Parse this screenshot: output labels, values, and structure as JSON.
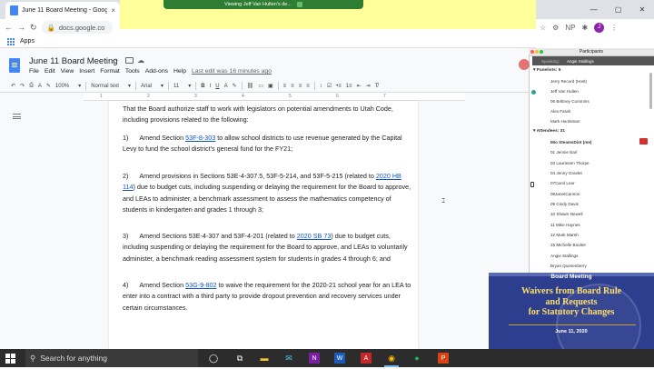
{
  "browser": {
    "tab_title": "June 11 Board Meeting - Google",
    "url": "docs.google.co",
    "bookmarks_apps": "Apps",
    "zoom_share_text": "Viewing Jeff Van Hulten's de...",
    "profile_initial": "J",
    "ext_label": "NP"
  },
  "doc": {
    "title": "June 11 Board Meeting",
    "menus": [
      "File",
      "Edit",
      "View",
      "Insert",
      "Format",
      "Tools",
      "Add-ons",
      "Help"
    ],
    "last_edit": "Last edit was 16 minutes ago",
    "toolbar": {
      "zoom": "100%",
      "style": "Normal text",
      "font": "Arial",
      "size": "11"
    },
    "ruler_marks": [
      "1",
      "2",
      "3",
      "4",
      "5",
      "6",
      "7"
    ],
    "paragraphs": {
      "intro": "That the Board authorize staff to work with legislators on potential amendments to Utah Code, including provisions related to the following:",
      "p1_pre": "1)      Amend Section ",
      "p1_link": "53F-8-303",
      "p1_post": " to allow school districts to use revenue generated by the Capital Levy to fund the school district's general fund for the FY21;",
      "p2_pre": "2)      Amend provisions in Sections 53E-4-307.5, 53F-5-214, and 53F-5-215 (related to ",
      "p2_link": "2020 HB 114",
      "p2_post": ") due to budget cuts, including suspending or delaying the requirement for the Board to approve, and LEAs to administer, a benchmark assessment to assess the mathematics competency of students in kindergarten and grades 1 through 3;",
      "p3_pre": "3)      Amend Sections 53E-4-307 and 53F-4-201 (related to ",
      "p3_link": "2020 SB 73",
      "p3_post": ") due to budget cuts, including suspending or delaying the requirement for the Board to approve, and LEAs to voluntarily administer, a benchmark reading assessment system for students in grades 4 through 6; and",
      "p4_pre": "4)      Amend Section ",
      "p4_link": "53G-9-802",
      "p4_post": " to waive the requirement for the 2020-21 school year for an LEA to enter into a contract with a third party to provide dropout prevention and recovery services under certain circumstances."
    }
  },
  "participants": {
    "title": "Participants",
    "speaking_label": "Speaking:",
    "speaking_name": "Angie Stallings",
    "panelists_header": "Panelists: 5",
    "panelists": [
      "Jerry Record (Host)",
      "Jeff Van Hulten",
      "06 Brittney Cummins",
      "Alex Farah",
      "Mark Huntsman"
    ],
    "attendees_header": "Attendees: 31",
    "attendees": [
      "Mio SteamsDiot (me)",
      "01 Jennie Earl",
      "03 Laurieann Thorpe",
      "04 Jenny Gravlet",
      "07Carol Lear",
      "08JanetCannon",
      "09 Cindy Davis",
      "10 Shawn Newell",
      "11 Mike Haynes",
      "12 Mark Marsh",
      "15 Michelle Boulter",
      "Angie Stallings",
      "Bryan Quesenberry"
    ]
  },
  "overlay": {
    "header": "Board Meeting",
    "line1": "Waivers from Board Rule",
    "line2": "and Requests",
    "line3": "for Statutory Changes",
    "date": "June 11, 2020"
  },
  "taskbar": {
    "search_placeholder": "Search for anything"
  },
  "colors": {
    "link": "#1155cc",
    "overlay_bg": "#2d3e8f",
    "overlay_text": "#ffe066"
  }
}
